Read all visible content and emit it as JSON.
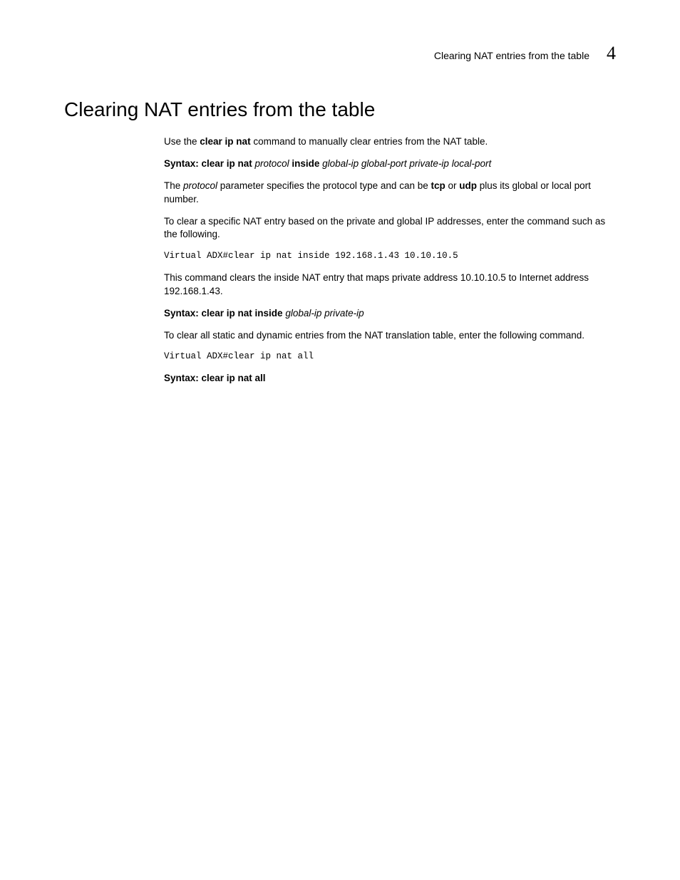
{
  "header": {
    "title": "Clearing NAT entries from the table",
    "chapter": "4"
  },
  "heading": "Clearing NAT entries from the table",
  "body": {
    "p1_a": "Use the ",
    "p1_b": "clear ip nat",
    "p1_c": " command to manually clear entries from the NAT table.",
    "p2_a": "Syntax:  clear ip nat ",
    "p2_b": "protocol",
    "p2_c": " inside ",
    "p2_d": "global-ip global-port private-ip local-port",
    "p3_a": "The ",
    "p3_b": "protocol",
    "p3_c": " parameter specifies the protocol type and can be ",
    "p3_d": "tcp",
    "p3_e": " or ",
    "p3_f": "udp",
    "p3_g": " plus its global or local port number.",
    "p4": "To clear a specific NAT entry based on the private and global IP addresses, enter the command such as the following.",
    "code1": "Virtual ADX#clear ip nat inside 192.168.1.43 10.10.10.5",
    "p5": "This command clears the inside NAT entry that maps private address 10.10.10.5 to Internet address 192.168.1.43.",
    "p6_a": "Syntax:  clear ip nat inside ",
    "p6_b": "global-ip private-ip",
    "p7": "To clear all static and dynamic entries from the NAT translation table, enter the following command.",
    "code2": "Virtual ADX#clear ip nat all",
    "p8": "Syntax:  clear ip nat all"
  }
}
